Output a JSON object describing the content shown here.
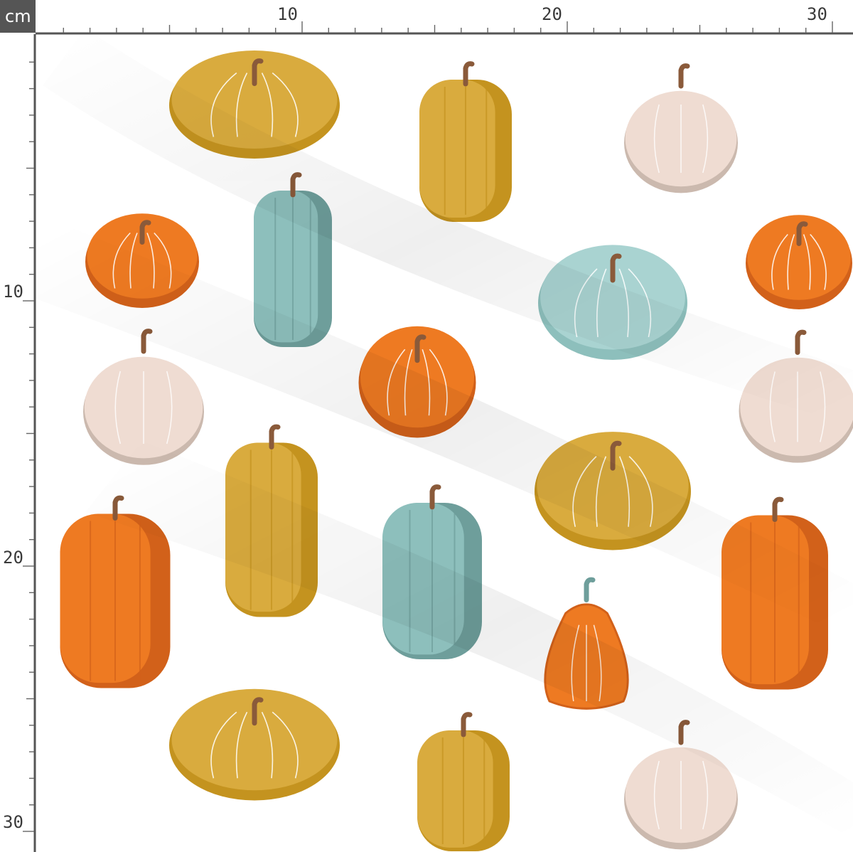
{
  "ruler": {
    "unit": "cm",
    "top_ticks": [
      "10",
      "20",
      "30"
    ],
    "left_ticks": [
      "10",
      "20",
      "30"
    ]
  },
  "colors": {
    "ruler_bg": "#ffffff",
    "ruler_line": "#555555",
    "unit_box": "#555555",
    "fabric": "#ffffff",
    "mustard": "#d9ab3e",
    "mustard_dark": "#c4931f",
    "teal": "#8dbfbc",
    "teal_dark": "#6e9e9b",
    "orange": "#ee7a22",
    "orange_dark": "#d2611a",
    "blush": "#efdcd2",
    "blush_dark": "#cbb9ae",
    "pale_blue": "#a9d3d1",
    "stem": "#8a5a3a"
  },
  "pattern": {
    "pumpkins": [
      {
        "kind": "flat",
        "color": "mustard"
      },
      {
        "kind": "tall",
        "color": "mustard"
      },
      {
        "kind": "round",
        "color": "blush"
      },
      {
        "kind": "flat",
        "color": "orange"
      },
      {
        "kind": "tall",
        "color": "teal"
      },
      {
        "kind": "flat",
        "color": "pale_blue"
      },
      {
        "kind": "flat",
        "color": "orange"
      },
      {
        "kind": "round",
        "color": "blush"
      },
      {
        "kind": "flat",
        "color": "orange"
      },
      {
        "kind": "round",
        "color": "blush"
      },
      {
        "kind": "tall",
        "color": "mustard"
      },
      {
        "kind": "flat",
        "color": "mustard"
      },
      {
        "kind": "tall",
        "color": "orange"
      },
      {
        "kind": "tall",
        "color": "teal"
      },
      {
        "kind": "pear",
        "color": "orange"
      },
      {
        "kind": "tall",
        "color": "orange"
      },
      {
        "kind": "flat",
        "color": "mustard"
      },
      {
        "kind": "tall",
        "color": "mustard"
      },
      {
        "kind": "round",
        "color": "blush"
      }
    ]
  }
}
